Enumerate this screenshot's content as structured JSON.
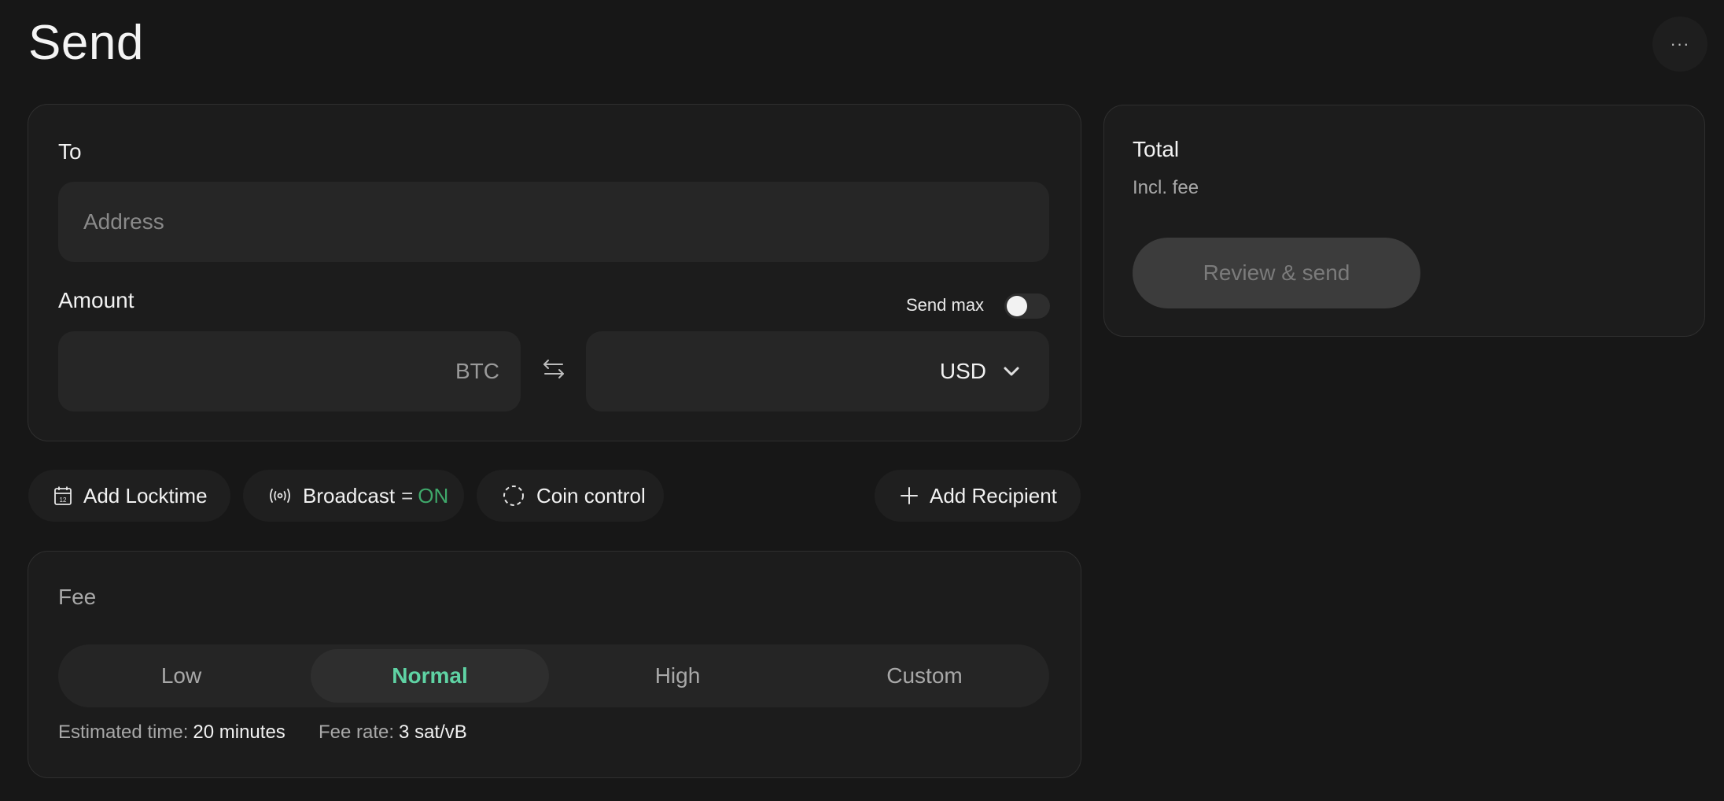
{
  "header": {
    "title": "Send",
    "more_label": "···"
  },
  "send": {
    "to_label": "To",
    "address_placeholder": "Address",
    "address_value": "",
    "amount_label": "Amount",
    "send_max_label": "Send max",
    "send_max_on": false,
    "btc_unit": "BTC",
    "btc_value": "",
    "fiat_unit": "USD",
    "fiat_value": ""
  },
  "actions": {
    "locktime_label": "Add Locktime",
    "broadcast_label": "Broadcast",
    "broadcast_eq": "=",
    "broadcast_state": "ON",
    "coin_control_label": "Coin control",
    "add_recipient_label": "Add Recipient"
  },
  "fee": {
    "label": "Fee",
    "options": [
      "Low",
      "Normal",
      "High",
      "Custom"
    ],
    "selected": "Normal",
    "estimated_time_label": "Estimated time:",
    "estimated_time_value": "20 minutes",
    "fee_rate_label": "Fee rate:",
    "fee_rate_value": "3 sat/vB"
  },
  "total": {
    "title": "Total",
    "subtitle": "Incl. fee",
    "review_button_label": "Review & send"
  },
  "colors": {
    "background": "#171717",
    "card": "#1c1c1c",
    "accent_green": "#5fd3a4",
    "on_green": "#3fa96b"
  }
}
